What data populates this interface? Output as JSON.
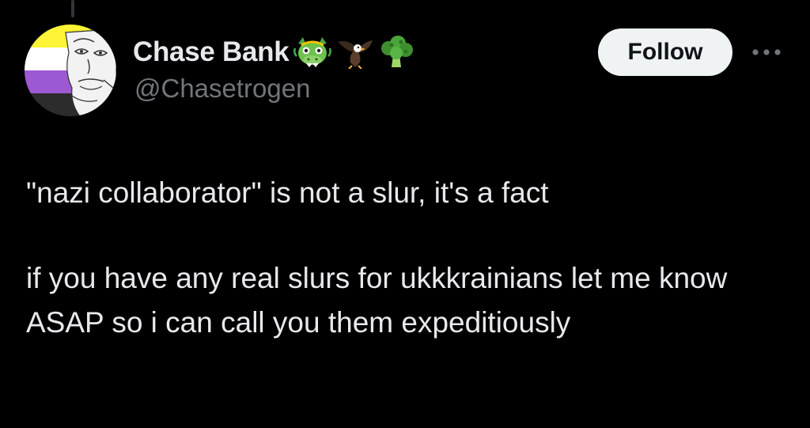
{
  "author": {
    "display_name": "Chase Bank",
    "handle": "@Chasetrogen",
    "name_emojis": [
      "dragon-face-icon",
      "eagle-icon",
      "broccoli-icon"
    ],
    "avatar_flag_colors": [
      "#fcf434",
      "#ffffff",
      "#9c59d1",
      "#2c2c2c"
    ]
  },
  "actions": {
    "follow_label": "Follow",
    "more_icon": "more-dots-icon"
  },
  "tweet": {
    "paragraph_1": "\"nazi collaborator\" is not a slur, it's a fact",
    "paragraph_2": "if you have any real slurs for ukkkrainians let me know ASAP so i can call you them expeditiously"
  },
  "colors": {
    "background": "#000000",
    "primary_text": "#e7e9ea",
    "secondary_text": "#71767b",
    "follow_bg": "#eff3f4",
    "follow_text": "#0f1419"
  }
}
